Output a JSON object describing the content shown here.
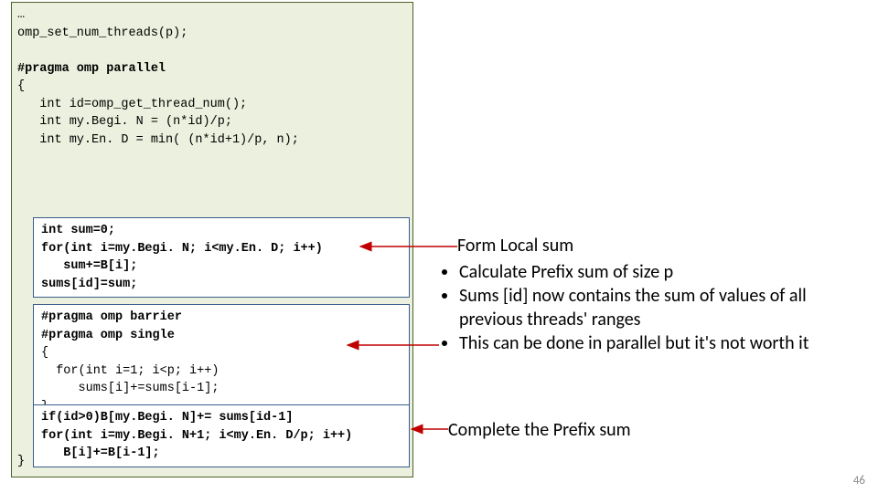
{
  "code": {
    "line1": "…",
    "line2": "omp_set_num_threads(p);",
    "pragma1": "#pragma omp parallel",
    "brace_open": "{",
    "decl1": "   int id=omp_get_thread_num();",
    "decl2": "   int my.Begi. N = (n*id)/p;",
    "decl3": "   int my.En. D = min( (n*id+1)/p, n);",
    "brace_close": "}"
  },
  "box1": {
    "l1": "int sum=0;",
    "l2": "for(int i=my.Begi. N; i<my.En. D; i++)",
    "l3": "   sum+=B[i];",
    "l4": "sums[id]=sum;"
  },
  "box2": {
    "l1": "#pragma omp barrier",
    "l2": "#pragma omp single",
    "l3": "{",
    "l4": "  for(int i=1; i<p; i++)",
    "l5": "     sums[i]+=sums[i-1];",
    "l6": "}"
  },
  "box3": {
    "l1": "if(id>0)B[my.Begi. N]+= sums[id-1]",
    "l2": "for(int i=my.Begi. N+1; i<my.En. D/p; i++)",
    "l3": "   B[i]+=B[i-1];"
  },
  "annot": {
    "form_local": "Form Local sum",
    "bullets": {
      "b1": "Calculate Prefix sum of size p",
      "b2": "Sums [id] now contains the sum of values of all previous threads' ranges",
      "b3": "This can be done in parallel but it's not worth it"
    },
    "complete": "Complete the Prefix sum"
  },
  "page": "46"
}
